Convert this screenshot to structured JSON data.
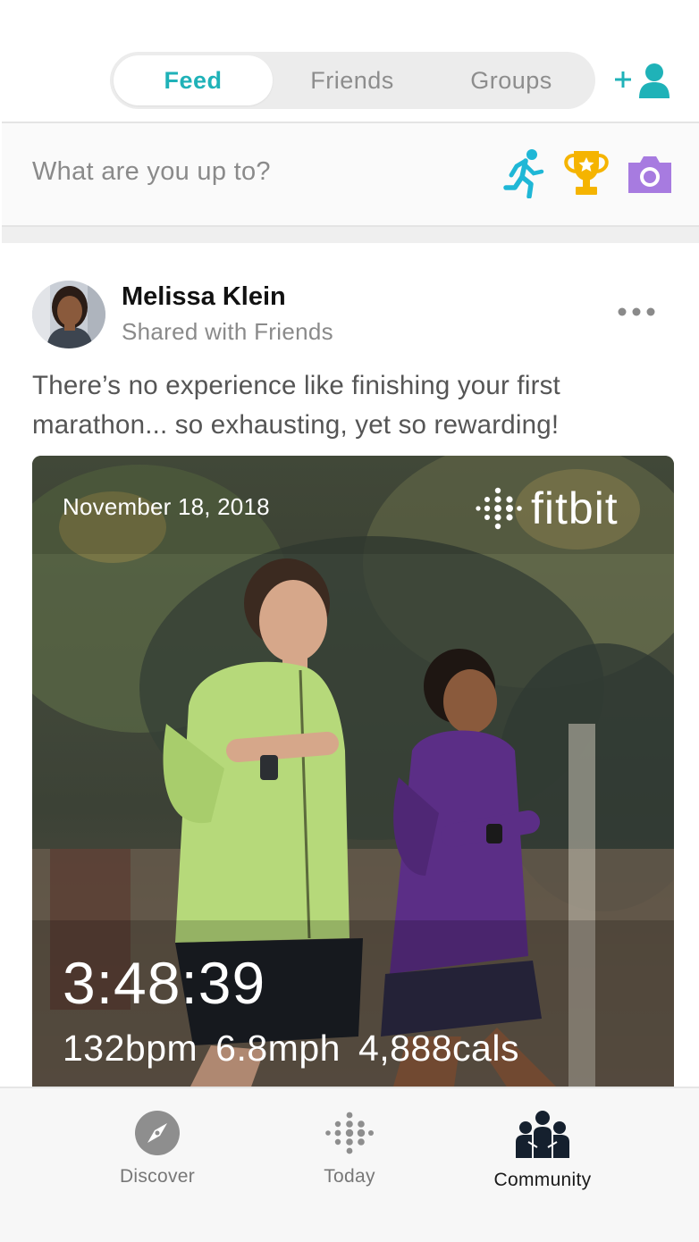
{
  "tabs": [
    {
      "label": "Feed",
      "active": true
    },
    {
      "label": "Friends",
      "active": false
    },
    {
      "label": "Groups",
      "active": false
    }
  ],
  "composer": {
    "placeholder": "What are you up to?",
    "icons": [
      "run-icon",
      "trophy-icon",
      "camera-icon"
    ]
  },
  "post": {
    "author": "Melissa Klein",
    "scope": "Shared with Friends",
    "text": "There’s no experience like finishing your first marathon... so exhausting, yet so rewarding!",
    "card": {
      "date": "November 18, 2018",
      "brand": "fitbit",
      "time": "3:48:39",
      "heart_rate": "132bpm",
      "speed": "6.8mph",
      "calories": "4,888cals"
    }
  },
  "nav": [
    {
      "label": "Discover",
      "icon": "compass-icon",
      "active": false
    },
    {
      "label": "Today",
      "icon": "fitbit-dots-icon",
      "active": false
    },
    {
      "label": "Community",
      "icon": "community-icon",
      "active": true
    }
  ],
  "colors": {
    "accent": "#1fb2b8",
    "trophy": "#f5b400",
    "camera": "#a77be0",
    "run": "#1fb7d6"
  }
}
